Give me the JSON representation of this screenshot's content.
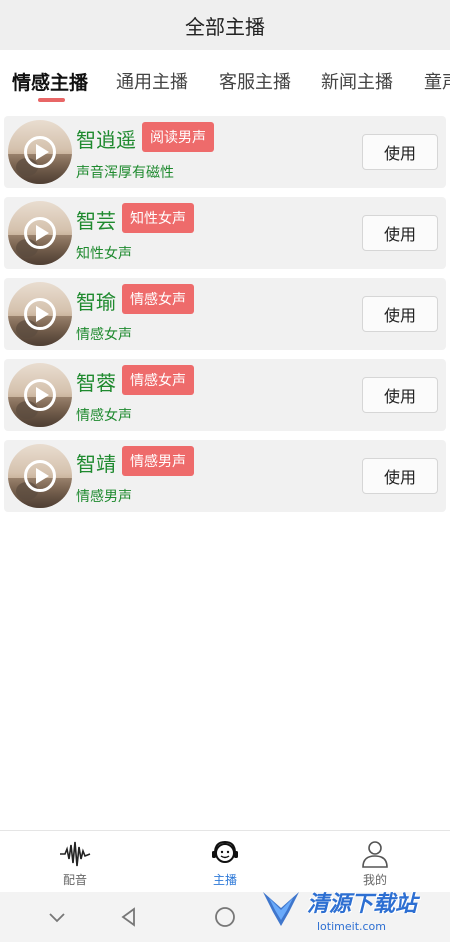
{
  "header": {
    "title": "全部主播"
  },
  "tabs": [
    {
      "label": "情感主播",
      "active": true
    },
    {
      "label": "通用主播",
      "active": false
    },
    {
      "label": "客服主播",
      "active": false
    },
    {
      "label": "新闻主播",
      "active": false
    },
    {
      "label": "童声",
      "active": false
    }
  ],
  "anchors": [
    {
      "name": "智逍遥",
      "tag": "阅读男声",
      "desc": "声音浑厚有磁性",
      "button": "使用"
    },
    {
      "name": "智芸",
      "tag": "知性女声",
      "desc": "知性女声",
      "button": "使用"
    },
    {
      "name": "智瑜",
      "tag": "情感女声",
      "desc": "情感女声",
      "button": "使用"
    },
    {
      "name": "智蓉",
      "tag": "情感女声",
      "desc": "情感女声",
      "button": "使用"
    },
    {
      "name": "智靖",
      "tag": "情感男声",
      "desc": "情感男声",
      "button": "使用"
    }
  ],
  "bottom_nav": [
    {
      "label": "配音",
      "icon": "waveform-icon",
      "active": false
    },
    {
      "label": "主播",
      "icon": "headset-icon",
      "active": true
    },
    {
      "label": "我的",
      "icon": "user-icon",
      "active": false
    }
  ],
  "watermark": {
    "text": "清源下载站",
    "url": "lotimeit.com"
  },
  "colors": {
    "accent": "#ee6b6b",
    "green_text": "#1f8a2f",
    "active_nav": "#2f7ad8"
  }
}
